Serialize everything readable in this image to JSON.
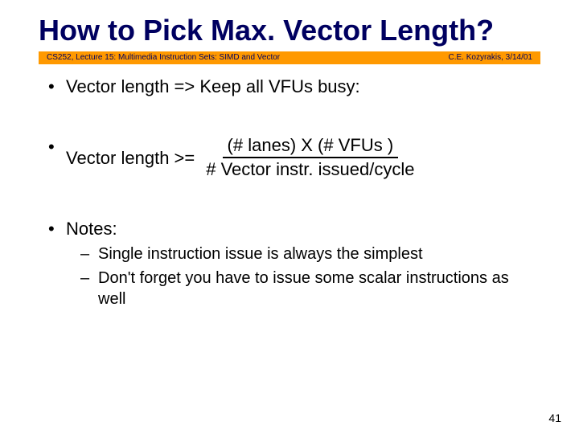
{
  "title": "How to Pick Max. Vector Length?",
  "bar": {
    "left": "CS252, Lecture 15: Multimedia Instruction Sets: SIMD and Vector",
    "right": "C.E. Kozyrakis, 3/14/01"
  },
  "bullets": {
    "b1": "Vector length => Keep all VFUs busy:",
    "b2_lead": "Vector length >=",
    "b2_num": "(# lanes) X (# VFUs )",
    "b2_den": "# Vector instr. issued/cycle",
    "b3": "Notes:",
    "b3_sub1": "Single instruction issue is always the simplest",
    "b3_sub2": "Don't forget you have to issue some scalar instructions as well"
  },
  "page_number": "41"
}
